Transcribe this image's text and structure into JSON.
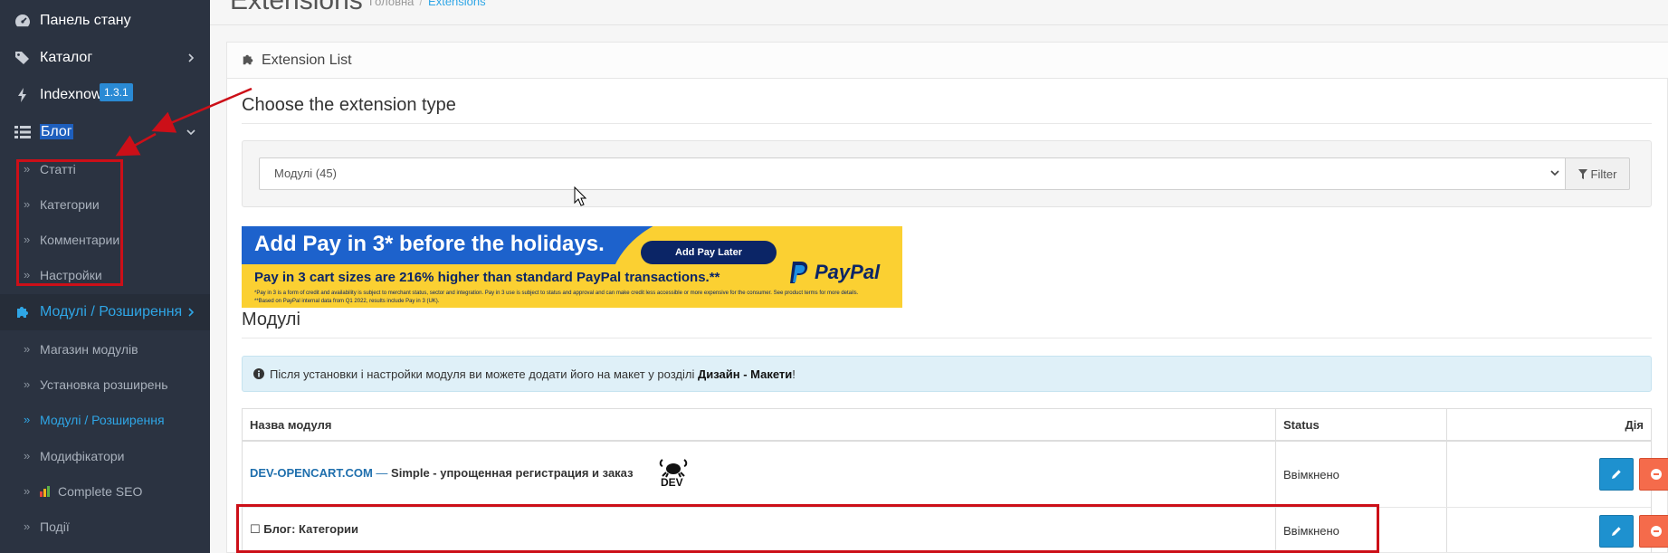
{
  "sidebar": {
    "items": [
      {
        "label": "Панель стану",
        "icon": "dashboard-icon"
      },
      {
        "label": "Каталог",
        "icon": "tags-icon"
      },
      {
        "label": "Indexnow",
        "icon": "bolt-icon",
        "badge": "1.3.1"
      },
      {
        "label": "Блог",
        "icon": "list-icon"
      },
      {
        "label": "Модулі / Розширення",
        "icon": "puzzle-icon"
      }
    ],
    "blog_sub": [
      "Статті",
      "Категории",
      "Комментарии",
      "Настройки"
    ],
    "ext_sub": [
      "Магазин модулів",
      "Установка розширень",
      "Модулі / Розширення",
      "Модифікатори",
      "Complete SEO",
      "Події"
    ]
  },
  "header": {
    "title": "Extensions",
    "breadcrumb": [
      "Головна",
      "Extensions"
    ]
  },
  "panel": {
    "heading": "Extension List",
    "choose_title": "Choose the extension type",
    "select_value": "Модулі (45)",
    "filter_label": "Filter"
  },
  "banner": {
    "headline": "Add Pay in 3* before the holidays.",
    "cta": "Add Pay Later",
    "sub": "Pay in 3 cart sizes are 216% higher than standard PayPal transactions.**",
    "fine1": "*Pay in 3 is a form of credit and availability is subject to merchant status, sector and integration. Pay in 3 use is subject to status and approval and can make credit less accessible or more expensive for the consumer. See product terms for more details.",
    "fine2": "**Based on PayPal internal data from Q1 2022, results include Pay in 3 (UK).",
    "logo": "PayPal"
  },
  "modules": {
    "title": "Модулі",
    "alert_prefix": "Після установки і настройки модуля ви можете додати його на макет у розділі",
    "alert_bold": "Дизайн - Макети",
    "alert_suffix": "!",
    "table": {
      "headers": [
        "Назва модуля",
        "Status",
        "Дія"
      ],
      "rows": [
        {
          "link": "DEV-OPENCART.COM",
          "dash": "—",
          "name": "Simple - упрощенная регистрация и заказ",
          "logo": "DEV",
          "status": "Ввімкнено"
        },
        {
          "checkbox": "☐",
          "name": "Блог: Категории",
          "status": "Ввімкнено"
        }
      ]
    }
  },
  "colors": {
    "sidebar_bg": "#2b3341",
    "accent": "#2fa6e6",
    "edit_btn": "#1e91cf",
    "delete_btn": "#f56b4b",
    "annotation": "#cc0f18"
  }
}
